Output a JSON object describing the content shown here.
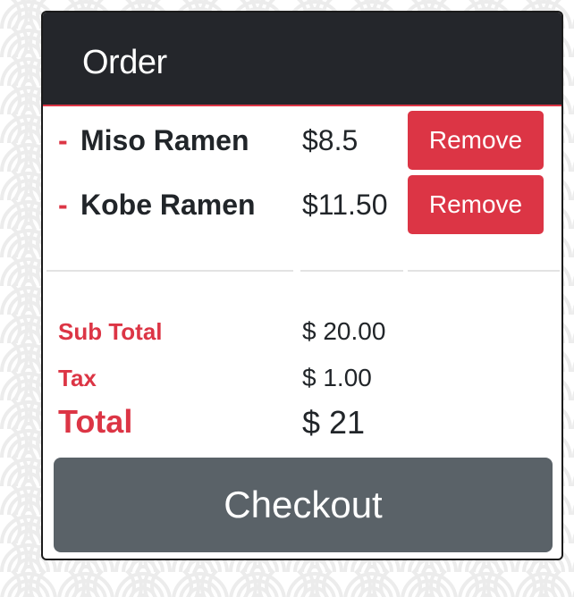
{
  "order": {
    "title": "Order",
    "items": [
      {
        "dash": "-",
        "name": "Miso Ramen",
        "price": "$8.5",
        "remove_label": "Remove"
      },
      {
        "dash": "-",
        "name": "Kobe Ramen",
        "price": "$11.50",
        "remove_label": "Remove"
      }
    ],
    "summary": {
      "subtotal_label": "Sub Total",
      "subtotal_value": "$ 20.00",
      "tax_label": "Tax",
      "tax_value": "$ 1.00",
      "total_label": "Total",
      "total_value": "$ 21"
    },
    "checkout_label": "Checkout"
  },
  "colors": {
    "accent": "#dc3545",
    "header_bg": "#24262b",
    "checkout_bg": "#5a6268",
    "text": "#212529"
  }
}
